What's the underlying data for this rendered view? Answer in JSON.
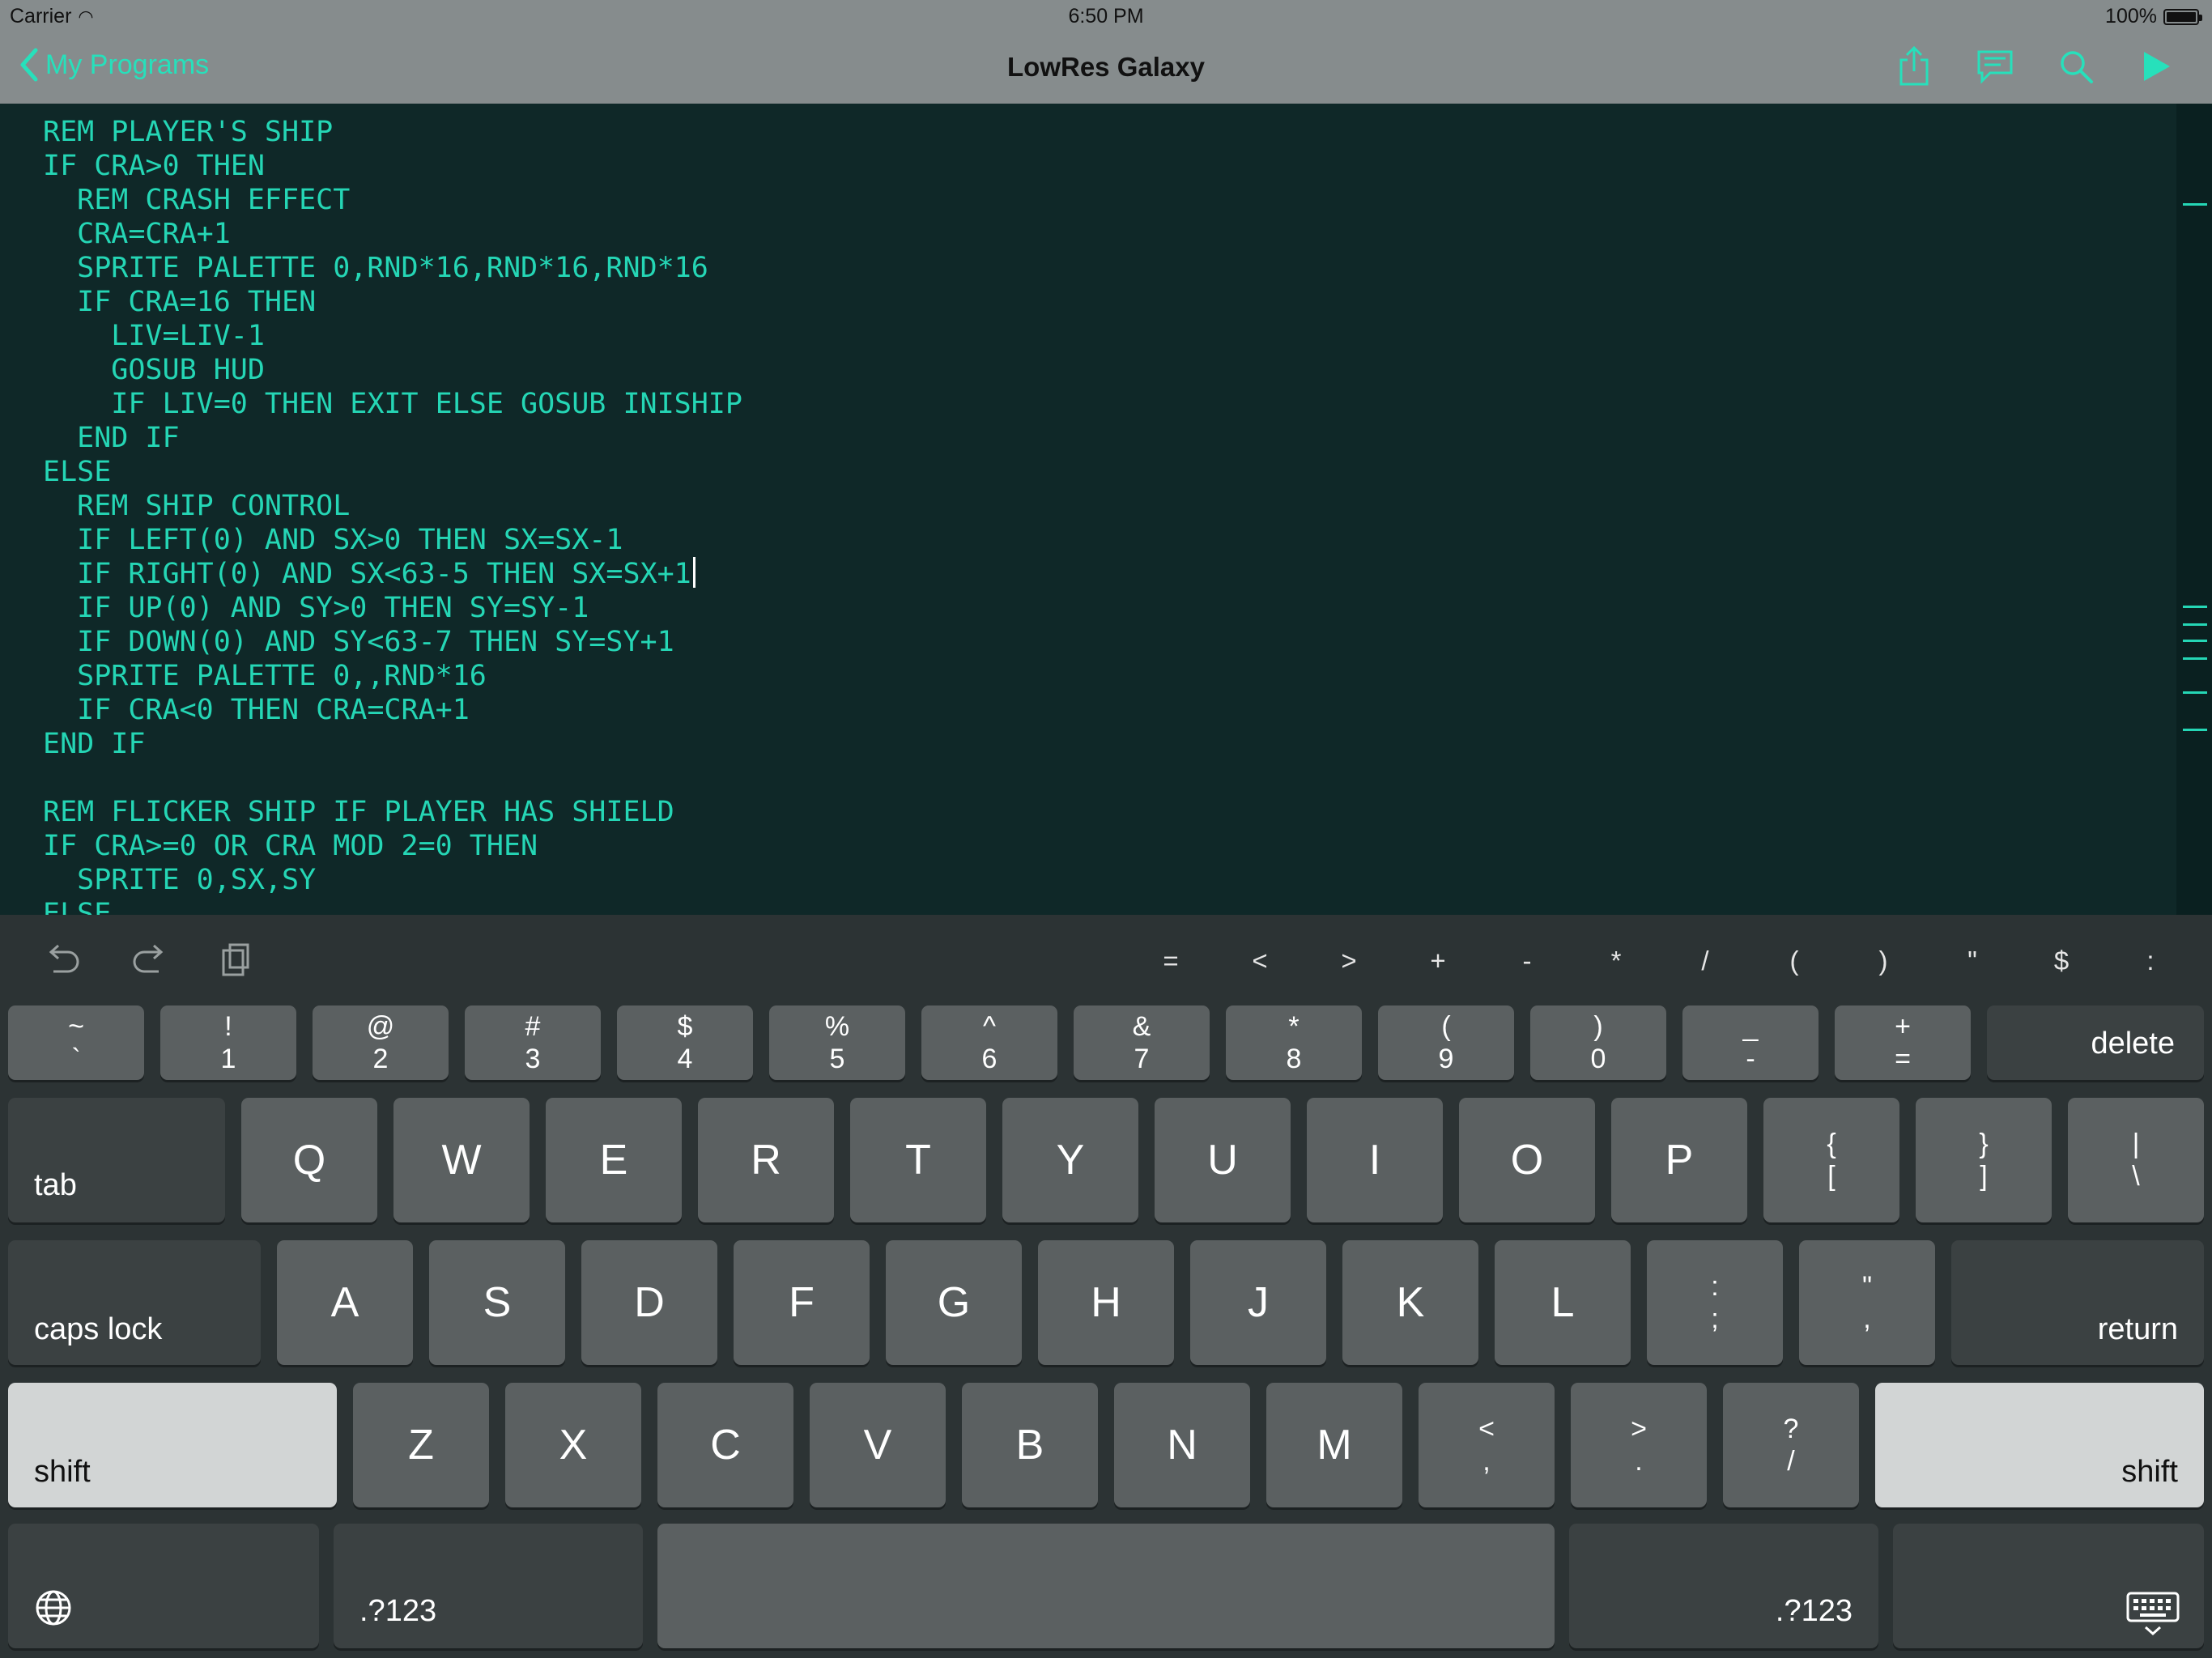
{
  "status": {
    "carrier": "Carrier",
    "time": "6:50 PM",
    "battery": "100%"
  },
  "nav": {
    "back_label": "My Programs",
    "title": "LowRes Galaxy",
    "actions": [
      "share-icon",
      "comment-icon",
      "search-icon",
      "run-icon"
    ]
  },
  "editor": {
    "lines": [
      "REM PLAYER'S SHIP",
      "IF CRA>0 THEN",
      "  REM CRASH EFFECT",
      "  CRA=CRA+1",
      "  SPRITE PALETTE 0,RND*16,RND*16,RND*16",
      "  IF CRA=16 THEN",
      "    LIV=LIV-1",
      "    GOSUB HUD",
      "    IF LIV=0 THEN EXIT ELSE GOSUB INISHIP",
      "  END IF",
      "ELSE",
      "  REM SHIP CONTROL",
      "  IF LEFT(0) AND SX>0 THEN SX=SX-1",
      "  IF RIGHT(0) AND SX<63-5 THEN SX=SX+1",
      "  IF UP(0) AND SY>0 THEN SY=SY-1",
      "  IF DOWN(0) AND SY<63-7 THEN SY=SY+1",
      "  SPRITE PALETTE 0,,RND*16",
      "  IF CRA<0 THEN CRA=CRA+1",
      "END IF",
      "",
      "REM FLICKER SHIP IF PLAYER HAS SHIELD",
      "IF CRA>=0 OR CRA MOD 2=0 THEN",
      "  SPRITE 0,SX,SY",
      "ELSE"
    ],
    "cursor_line": 13
  },
  "accessory": {
    "tools": [
      "undo-icon",
      "redo-icon",
      "paste-icon"
    ],
    "symbols": [
      "=",
      "<",
      ">",
      "+",
      "-",
      "*",
      "/",
      "(",
      ")",
      "\"",
      "$",
      ":"
    ]
  },
  "keyboard": {
    "row1": [
      {
        "top": "~",
        "bottom": "`"
      },
      {
        "top": "!",
        "bottom": "1"
      },
      {
        "top": "@",
        "bottom": "2"
      },
      {
        "top": "#",
        "bottom": "3"
      },
      {
        "top": "$",
        "bottom": "4"
      },
      {
        "top": "%",
        "bottom": "5"
      },
      {
        "top": "^",
        "bottom": "6"
      },
      {
        "top": "&",
        "bottom": "7"
      },
      {
        "top": "*",
        "bottom": "8"
      },
      {
        "top": "(",
        "bottom": "9"
      },
      {
        "top": ")",
        "bottom": "0"
      },
      {
        "top": "_",
        "bottom": "-"
      },
      {
        "top": "+",
        "bottom": "="
      }
    ],
    "delete_label": "delete",
    "tab_label": "tab",
    "row2": [
      "Q",
      "W",
      "E",
      "R",
      "T",
      "Y",
      "U",
      "I",
      "O",
      "P"
    ],
    "row2_sym": [
      {
        "top": "{",
        "bottom": "["
      },
      {
        "top": "}",
        "bottom": "]"
      },
      {
        "top": "|",
        "bottom": "\\"
      }
    ],
    "caps_label": "caps lock",
    "row3": [
      "A",
      "S",
      "D",
      "F",
      "G",
      "H",
      "J",
      "K",
      "L"
    ],
    "row3_sym": [
      {
        "top": ":",
        "bottom": ";"
      },
      {
        "top": "\"",
        "bottom": ","
      }
    ],
    "return_label": "return",
    "shift_label": "shift",
    "row4": [
      "Z",
      "X",
      "C",
      "V",
      "B",
      "N",
      "M"
    ],
    "row4_sym": [
      {
        "top": "<",
        "bottom": ","
      },
      {
        "top": ">",
        "bottom": "."
      },
      {
        "top": "?",
        "bottom": "/"
      }
    ],
    "numbers_label": ".?123",
    "globe_icon": "globe-icon",
    "dismiss_icon": "keyboard-dismiss-icon"
  }
}
